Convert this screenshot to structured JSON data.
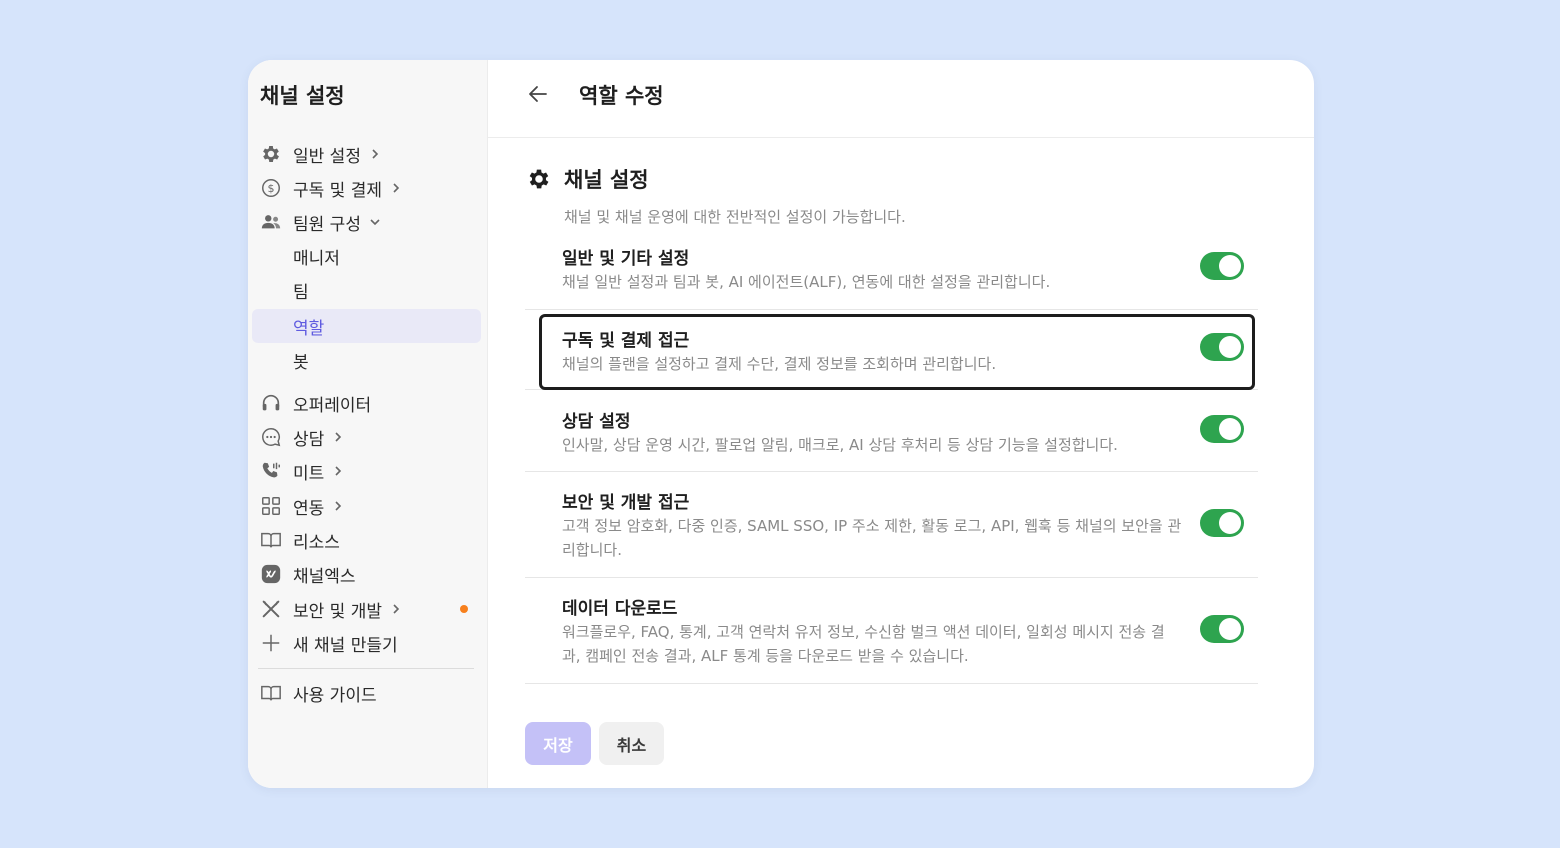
{
  "sidebar": {
    "title": "채널 설정",
    "items": [
      {
        "label": "일반 설정",
        "icon": "gear-icon"
      },
      {
        "label": "구독 및 결제",
        "icon": "dollar-circle-icon"
      },
      {
        "label": "팀원 구성",
        "icon": "people-icon"
      },
      {
        "label": "오퍼레이터",
        "icon": "headset-icon"
      },
      {
        "label": "상담",
        "icon": "chat-bubble-icon"
      },
      {
        "label": "미트",
        "icon": "phone-icon"
      },
      {
        "label": "연동",
        "icon": "grid-icon"
      },
      {
        "label": "리소스",
        "icon": "book-icon"
      },
      {
        "label": "채널엑스",
        "icon": "channelx-icon"
      },
      {
        "label": "보안 및 개발",
        "icon": "tools-icon"
      },
      {
        "label": "새 채널 만들기",
        "icon": "plus-icon"
      }
    ],
    "team_sub_items": [
      {
        "label": "매니저"
      },
      {
        "label": "팀"
      },
      {
        "label": "역할"
      },
      {
        "label": "봇"
      }
    ],
    "guide": {
      "label": "사용 가이드",
      "icon": "book-icon"
    },
    "accent_color": "#5f5be0",
    "notification_color": "#f7801d"
  },
  "header": {
    "title": "역할 수정"
  },
  "section": {
    "title": "채널 설정",
    "description": "채널 및 채널 운영에 대한 전반적인 설정이 가능합니다."
  },
  "permissions": [
    {
      "title": "일반 및 기타 설정",
      "description": "채널 일반 설정과 팀과 봇, AI 에이전트(ALF), 연동에 대한 설정을 관리합니다.",
      "enabled": true
    },
    {
      "title": "구독 및 결제 접근",
      "description": "채널의 플랜을 설정하고 결제 수단, 결제 정보를 조회하며 관리합니다.",
      "enabled": true
    },
    {
      "title": "상담 설정",
      "description": "인사말, 상담 운영 시간, 팔로업 알림, 매크로, AI 상담 후처리 등 상담 기능을 설정합니다.",
      "enabled": true
    },
    {
      "title": "보안 및 개발 접근",
      "description": "고객 정보 암호화, 다중 인증, SAML SSO, IP 주소 제한, 활동 로그, API, 웹훅 등 채널의 보안을 관리합니다.",
      "enabled": true
    },
    {
      "title": "데이터 다운로드",
      "description": "워크플로우, FAQ, 통계, 고객 연락처 유저 정보, 수신함 벌크 액션 데이터, 일회성 메시지 전송 결과, 캠페인 전송 결과, ALF 통계 등을 다운로드 받을 수 있습니다.",
      "enabled": true
    }
  ],
  "buttons": {
    "save": "저장",
    "cancel": "취소"
  },
  "colors": {
    "toggle_on": "#2ea44f",
    "save_button": "#c4c1f7",
    "background": "#d6e4fb"
  }
}
